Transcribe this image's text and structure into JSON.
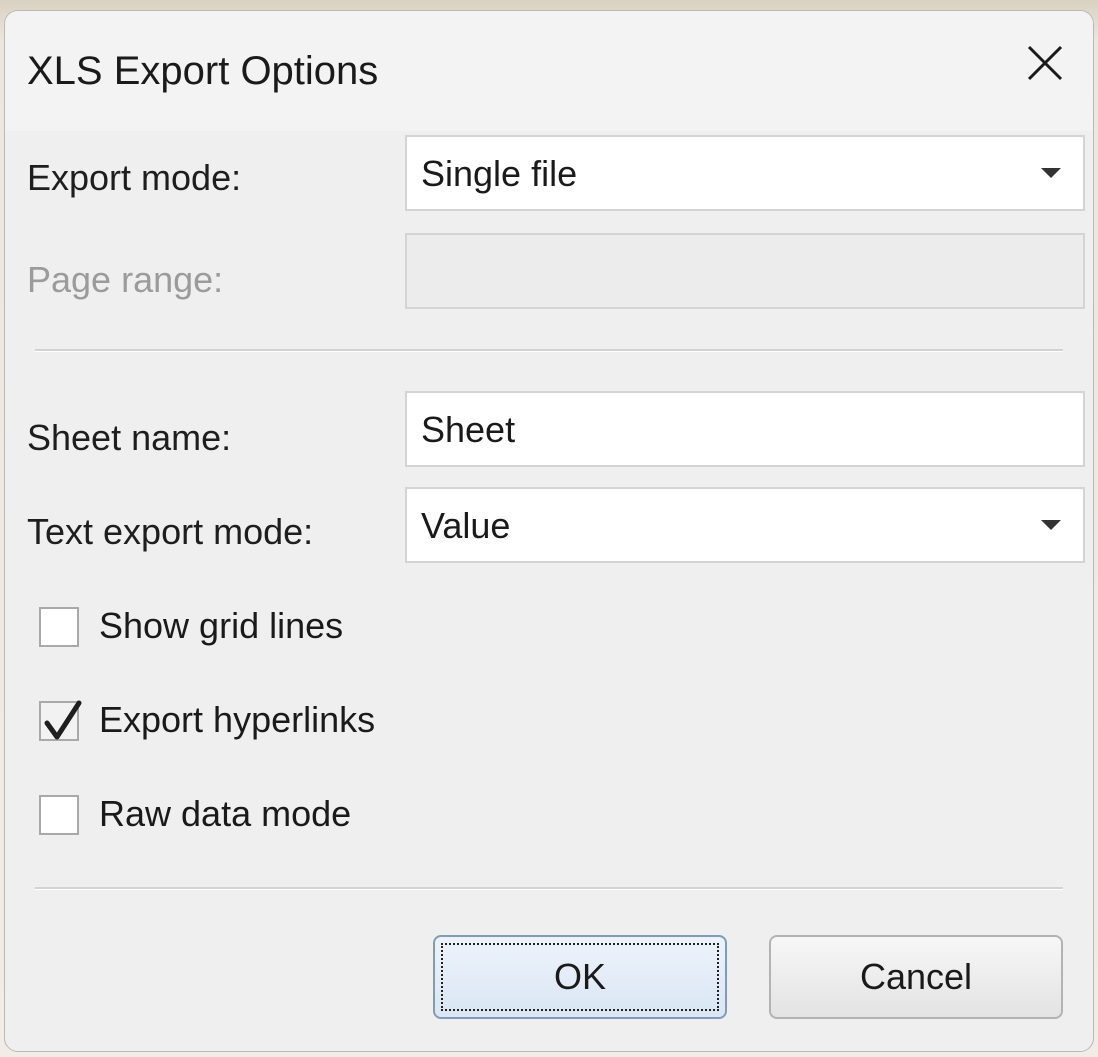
{
  "dialog": {
    "title": "XLS Export Options",
    "close_icon": "close-icon"
  },
  "form": {
    "export_mode": {
      "label": "Export mode:",
      "value": "Single file"
    },
    "page_range": {
      "label": "Page range:",
      "value": "",
      "disabled": true
    },
    "sheet_name": {
      "label": "Sheet name:",
      "value": "Sheet"
    },
    "text_export_mode": {
      "label": "Text export mode:",
      "value": "Value"
    }
  },
  "options": {
    "show_grid_lines": {
      "label": "Show grid lines",
      "checked": false
    },
    "export_hyperlinks": {
      "label": "Export hyperlinks",
      "checked": true
    },
    "raw_data_mode": {
      "label": "Raw data mode",
      "checked": false
    }
  },
  "buttons": {
    "ok_label": "OK",
    "cancel_label": "Cancel"
  },
  "colors": {
    "dialog_background": "#efefef",
    "disabled_text": "#9b9b9b",
    "default_button_border": "#7f9db9"
  }
}
